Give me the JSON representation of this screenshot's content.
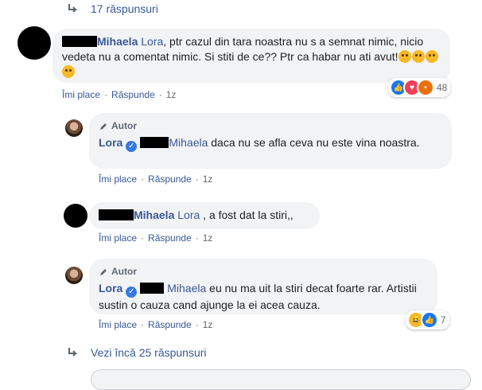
{
  "top_replies": {
    "label": "17 răspunsuri"
  },
  "comment1": {
    "name": "Mihaela",
    "mention": "Lora",
    "text": ", ptr cazul din tara noastra nu s a semnat nimic, nicio vedeta nu a comentat nimic. Si stiti de ce?? Ptr ca habar nu ati avut!",
    "like": "Îmi place",
    "reply": "Răspunde",
    "time": "1z",
    "reactions": {
      "count": "48",
      "icons": [
        "like-icon",
        "love-icon",
        "angry-icon"
      ]
    }
  },
  "reply1": {
    "author_tag": "Autor",
    "name": "Lora",
    "mention": "Mihaela",
    "text": " daca nu se afla ceva nu este vina noastra.",
    "like": "Îmi place",
    "reply": "Răspunde",
    "time": "1z"
  },
  "reply2": {
    "name": "Mihaela",
    "mention": "Lora",
    "text": " , a fost dat la stiri,,",
    "like": "Îmi place",
    "reply": "Răspunde",
    "time": "1z"
  },
  "reply3": {
    "author_tag": "Autor",
    "name": "Lora",
    "mention": "Mihaela",
    "text": " eu nu ma uit la stiri decat foarte rar. Artistii sustin o cauza cand ajunge la ei acea cauza.",
    "like": "Îmi place",
    "reply": "Răspunde",
    "time": "1z",
    "reactions": {
      "count": "7",
      "icons": [
        "haha-icon",
        "like-icon"
      ]
    }
  },
  "more_replies": {
    "label": "Vezi încă 25 răspunsuri"
  }
}
